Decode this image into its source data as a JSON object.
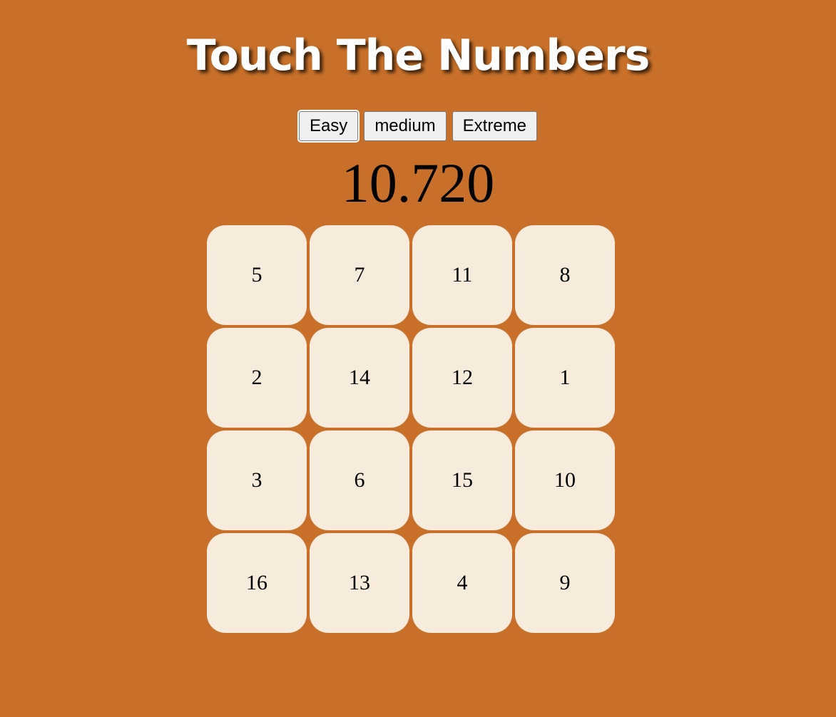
{
  "title": "Touch The Numbers",
  "modes": [
    {
      "label": "Easy",
      "active": true
    },
    {
      "label": "medium",
      "active": false
    },
    {
      "label": "Extreme",
      "active": false
    }
  ],
  "timer": "10.720",
  "grid": {
    "tiles": [
      "5",
      "7",
      "11",
      "8",
      "2",
      "14",
      "12",
      "1",
      "3",
      "6",
      "15",
      "10",
      "16",
      "13",
      "4",
      "9"
    ]
  },
  "colors": {
    "background": "#c87029",
    "tile": "#f7ecdc",
    "title": "#ffffff"
  }
}
